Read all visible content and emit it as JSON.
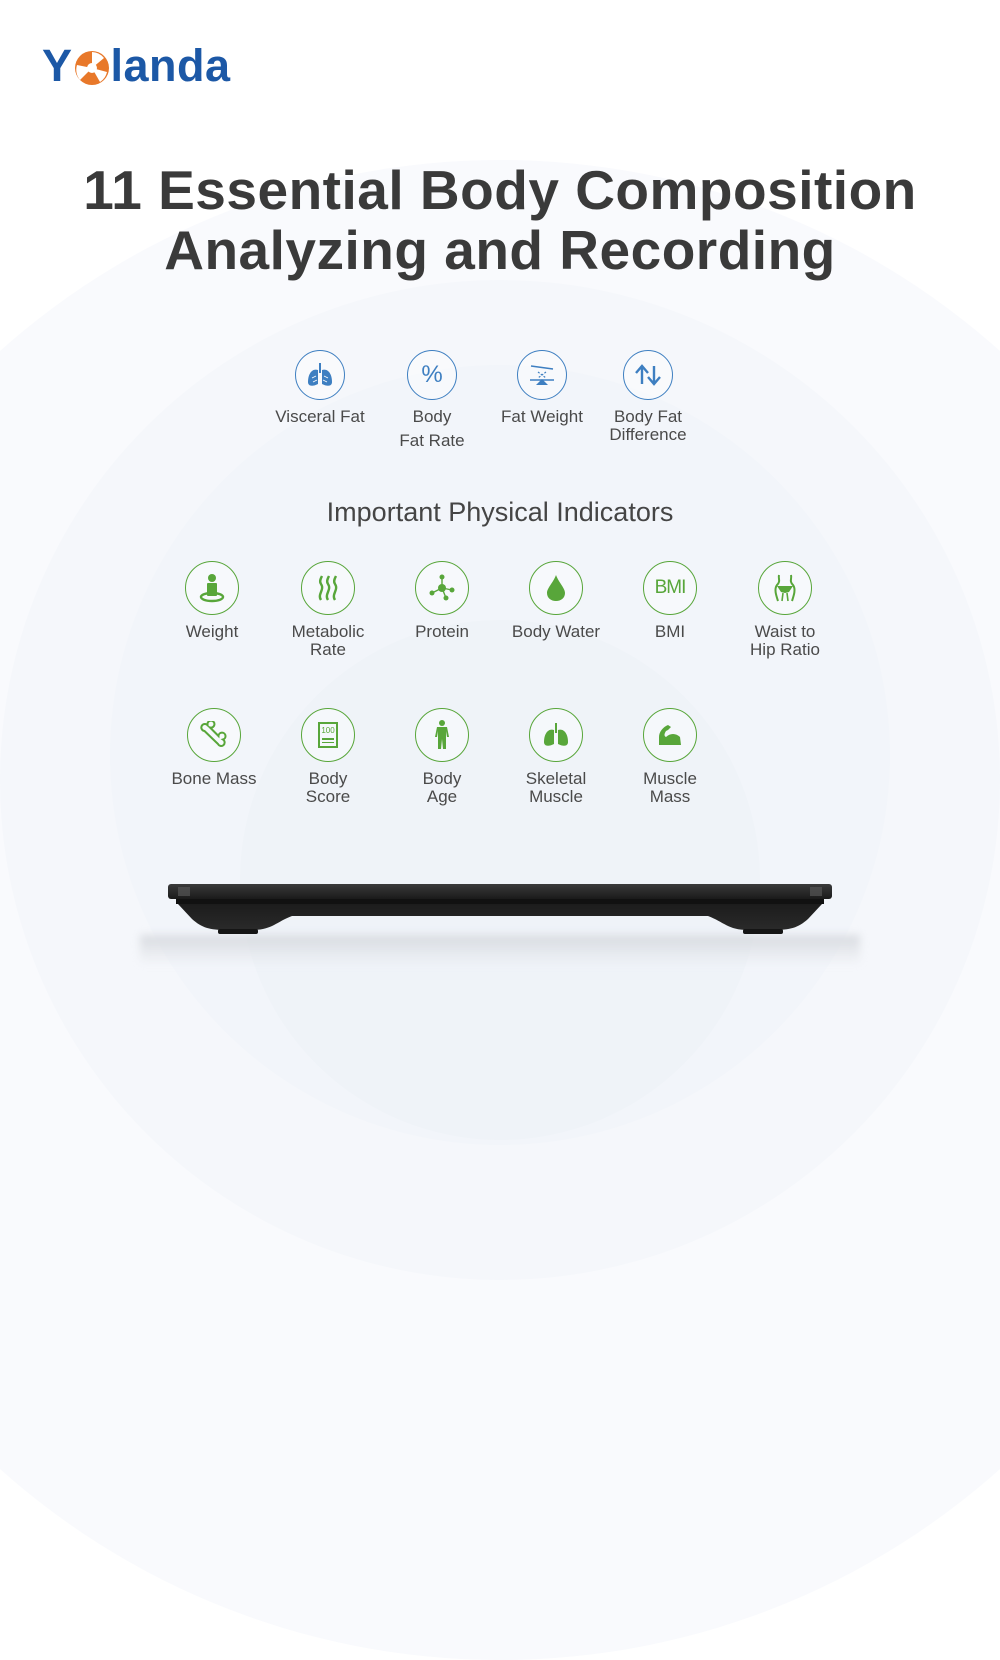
{
  "brand": {
    "name_first": "Y",
    "name_rest": "landa",
    "logo_color": "#1c58a6",
    "logo_accent": "#e8782a"
  },
  "headline": {
    "line1": "11 Essential Body Composition",
    "line2": "Analyzing and Recording"
  },
  "body_fat_group": {
    "accent": "#3e7fc1",
    "items": [
      {
        "label": "Visceral Fat",
        "icon": "lungs-icon"
      },
      {
        "label": "Body Fat Rate",
        "label_line1": "Body",
        "label_line2": "Fat Rate",
        "icon": "percent-icon"
      },
      {
        "label": "Fat Weight",
        "icon": "balance-scale-icon"
      },
      {
        "label": "Body Fat Difference",
        "label_line1": "Body Fat",
        "label_line2": "Difference",
        "icon": "up-down-arrows-icon"
      }
    ]
  },
  "physical_indicators": {
    "title": "Important Physical Indicators",
    "accent": "#58a63a",
    "items": [
      {
        "label_line1": "Weight",
        "label_line2": "",
        "icon": "person-on-scale-icon"
      },
      {
        "label_line1": "Metabolic",
        "label_line2": "Rate",
        "icon": "heat-waves-icon"
      },
      {
        "label_line1": "Protein",
        "label_line2": "",
        "icon": "molecule-icon"
      },
      {
        "label_line1": "Body Water",
        "label_line2": "",
        "icon": "water-drop-icon"
      },
      {
        "label_line1": "BMI",
        "label_line2": "",
        "icon": "bmi-text-icon",
        "icon_text": "BMI"
      },
      {
        "label_line1": "Waist to",
        "label_line2": "Hip Ratio",
        "icon": "waist-icon"
      },
      {
        "label_line1": "Bone Mass",
        "label_line2": "",
        "icon": "bone-icon"
      },
      {
        "label_line1": "Body",
        "label_line2": "Score",
        "icon": "score-card-icon",
        "icon_text": "100"
      },
      {
        "label_line1": "Body",
        "label_line2": "Age",
        "icon": "human-figure-icon"
      },
      {
        "label_line1": "Skeletal",
        "label_line2": "Muscle",
        "icon": "lungs-icon"
      },
      {
        "label_line1": "Muscle",
        "label_line2": "Mass",
        "icon": "flexed-arm-icon"
      }
    ]
  }
}
